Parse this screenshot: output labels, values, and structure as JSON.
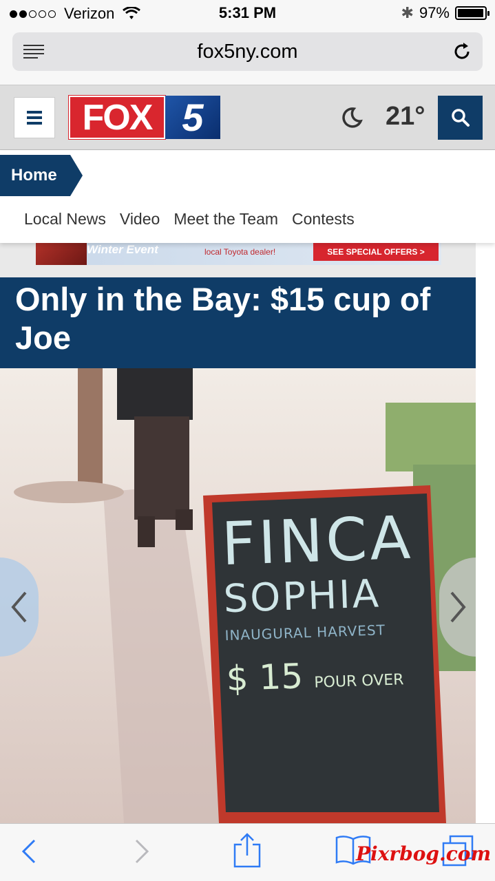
{
  "status_bar": {
    "carrier": "Verizon",
    "time": "5:31 PM",
    "battery": "97%",
    "battery_level": 0.97
  },
  "browser": {
    "url": "fox5ny.com"
  },
  "site": {
    "logo_fox": "FOX",
    "logo_number": "5",
    "temperature": "21°",
    "weather_icon": "moon-icon"
  },
  "nav": {
    "home": "Home",
    "links": [
      "Local News",
      "Video",
      "Meet the Team",
      "Contests"
    ]
  },
  "ad": {
    "event": "Winter Event",
    "dealer": "local Toyota dealer!",
    "cta": "SEE SPECIAL OFFERS >"
  },
  "article": {
    "headline": "Only in the Bay: $15 cup of Joe"
  },
  "photo": {
    "sign_line1": "FINCA",
    "sign_line2": "SOPHIA",
    "sign_line3": "INAUGURAL HARVEST",
    "sign_price": "$ 15",
    "sign_pour": "POUR OVER"
  },
  "watermark": "Pixrbog.com",
  "colors": {
    "brand_navy": "#0f3c67",
    "fox_red": "#d9262e",
    "ios_blue": "#2f7bf5"
  }
}
